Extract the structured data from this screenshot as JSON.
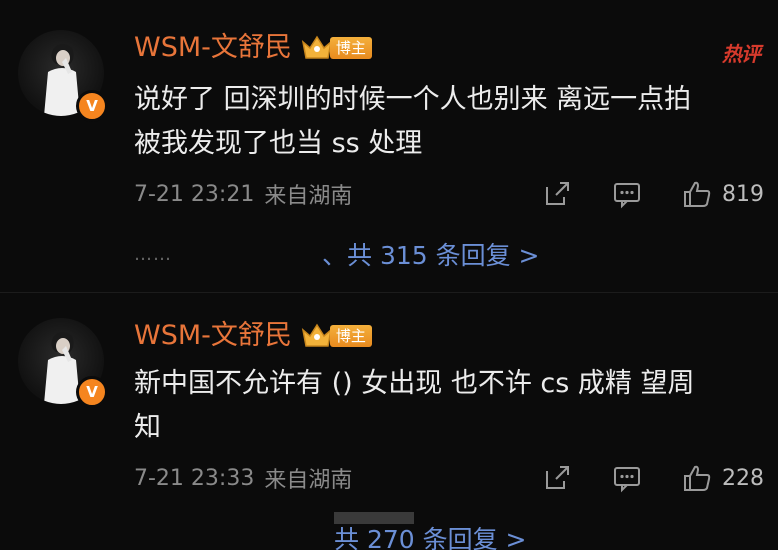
{
  "comments": [
    {
      "username": "WSM-文舒民",
      "badge": "博主",
      "hot_tag": "热评",
      "text_line1": "说好了 回深圳的时候一个人也别来 离远一点拍",
      "text_line2": "被我发现了也当 ss 处理",
      "time": "7-21 23:21",
      "location": "来自湖南",
      "likes": "819",
      "reply_dots": "……",
      "reply_link": "、共 315 条回复 >"
    },
    {
      "username": "WSM-文舒民",
      "badge": "博主",
      "text_line1": "新中国不允许有 () 女出现 也不许 cs 成精 望周",
      "text_line2": "知",
      "time": "7-21 23:33",
      "location": "来自湖南",
      "likes": "228",
      "reply_link": "共 270 条回复 >"
    }
  ],
  "icons": {
    "verified": "verified-v-icon",
    "crown": "crown-icon",
    "share": "share-icon",
    "comment": "comment-icon",
    "like": "thumbs-up-icon"
  },
  "colors": {
    "username": "#e8753a",
    "verified": "#f5851f",
    "hot_tag": "#d63a2c",
    "reply_link": "#6b8fd6"
  }
}
